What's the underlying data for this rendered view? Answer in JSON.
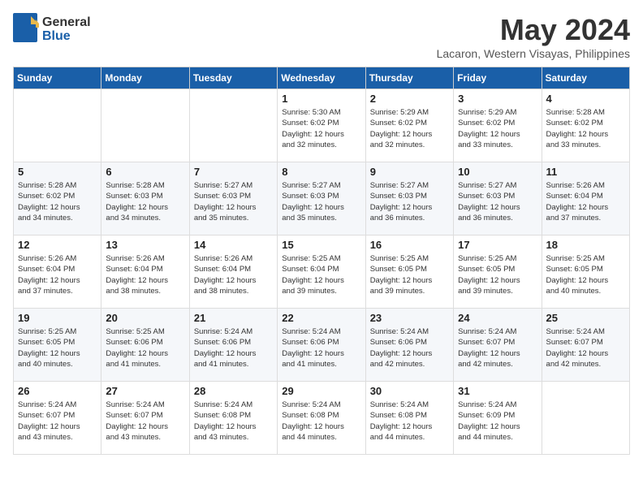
{
  "logo": {
    "general": "General",
    "blue": "Blue"
  },
  "title": "May 2024",
  "location": "Lacaron, Western Visayas, Philippines",
  "days_header": [
    "Sunday",
    "Monday",
    "Tuesday",
    "Wednesday",
    "Thursday",
    "Friday",
    "Saturday"
  ],
  "weeks": [
    [
      {
        "day": "",
        "info": ""
      },
      {
        "day": "",
        "info": ""
      },
      {
        "day": "",
        "info": ""
      },
      {
        "day": "1",
        "info": "Sunrise: 5:30 AM\nSunset: 6:02 PM\nDaylight: 12 hours\nand 32 minutes."
      },
      {
        "day": "2",
        "info": "Sunrise: 5:29 AM\nSunset: 6:02 PM\nDaylight: 12 hours\nand 32 minutes."
      },
      {
        "day": "3",
        "info": "Sunrise: 5:29 AM\nSunset: 6:02 PM\nDaylight: 12 hours\nand 33 minutes."
      },
      {
        "day": "4",
        "info": "Sunrise: 5:28 AM\nSunset: 6:02 PM\nDaylight: 12 hours\nand 33 minutes."
      }
    ],
    [
      {
        "day": "5",
        "info": "Sunrise: 5:28 AM\nSunset: 6:02 PM\nDaylight: 12 hours\nand 34 minutes."
      },
      {
        "day": "6",
        "info": "Sunrise: 5:28 AM\nSunset: 6:03 PM\nDaylight: 12 hours\nand 34 minutes."
      },
      {
        "day": "7",
        "info": "Sunrise: 5:27 AM\nSunset: 6:03 PM\nDaylight: 12 hours\nand 35 minutes."
      },
      {
        "day": "8",
        "info": "Sunrise: 5:27 AM\nSunset: 6:03 PM\nDaylight: 12 hours\nand 35 minutes."
      },
      {
        "day": "9",
        "info": "Sunrise: 5:27 AM\nSunset: 6:03 PM\nDaylight: 12 hours\nand 36 minutes."
      },
      {
        "day": "10",
        "info": "Sunrise: 5:27 AM\nSunset: 6:03 PM\nDaylight: 12 hours\nand 36 minutes."
      },
      {
        "day": "11",
        "info": "Sunrise: 5:26 AM\nSunset: 6:04 PM\nDaylight: 12 hours\nand 37 minutes."
      }
    ],
    [
      {
        "day": "12",
        "info": "Sunrise: 5:26 AM\nSunset: 6:04 PM\nDaylight: 12 hours\nand 37 minutes."
      },
      {
        "day": "13",
        "info": "Sunrise: 5:26 AM\nSunset: 6:04 PM\nDaylight: 12 hours\nand 38 minutes."
      },
      {
        "day": "14",
        "info": "Sunrise: 5:26 AM\nSunset: 6:04 PM\nDaylight: 12 hours\nand 38 minutes."
      },
      {
        "day": "15",
        "info": "Sunrise: 5:25 AM\nSunset: 6:04 PM\nDaylight: 12 hours\nand 39 minutes."
      },
      {
        "day": "16",
        "info": "Sunrise: 5:25 AM\nSunset: 6:05 PM\nDaylight: 12 hours\nand 39 minutes."
      },
      {
        "day": "17",
        "info": "Sunrise: 5:25 AM\nSunset: 6:05 PM\nDaylight: 12 hours\nand 39 minutes."
      },
      {
        "day": "18",
        "info": "Sunrise: 5:25 AM\nSunset: 6:05 PM\nDaylight: 12 hours\nand 40 minutes."
      }
    ],
    [
      {
        "day": "19",
        "info": "Sunrise: 5:25 AM\nSunset: 6:05 PM\nDaylight: 12 hours\nand 40 minutes."
      },
      {
        "day": "20",
        "info": "Sunrise: 5:25 AM\nSunset: 6:06 PM\nDaylight: 12 hours\nand 41 minutes."
      },
      {
        "day": "21",
        "info": "Sunrise: 5:24 AM\nSunset: 6:06 PM\nDaylight: 12 hours\nand 41 minutes."
      },
      {
        "day": "22",
        "info": "Sunrise: 5:24 AM\nSunset: 6:06 PM\nDaylight: 12 hours\nand 41 minutes."
      },
      {
        "day": "23",
        "info": "Sunrise: 5:24 AM\nSunset: 6:06 PM\nDaylight: 12 hours\nand 42 minutes."
      },
      {
        "day": "24",
        "info": "Sunrise: 5:24 AM\nSunset: 6:07 PM\nDaylight: 12 hours\nand 42 minutes."
      },
      {
        "day": "25",
        "info": "Sunrise: 5:24 AM\nSunset: 6:07 PM\nDaylight: 12 hours\nand 42 minutes."
      }
    ],
    [
      {
        "day": "26",
        "info": "Sunrise: 5:24 AM\nSunset: 6:07 PM\nDaylight: 12 hours\nand 43 minutes."
      },
      {
        "day": "27",
        "info": "Sunrise: 5:24 AM\nSunset: 6:07 PM\nDaylight: 12 hours\nand 43 minutes."
      },
      {
        "day": "28",
        "info": "Sunrise: 5:24 AM\nSunset: 6:08 PM\nDaylight: 12 hours\nand 43 minutes."
      },
      {
        "day": "29",
        "info": "Sunrise: 5:24 AM\nSunset: 6:08 PM\nDaylight: 12 hours\nand 44 minutes."
      },
      {
        "day": "30",
        "info": "Sunrise: 5:24 AM\nSunset: 6:08 PM\nDaylight: 12 hours\nand 44 minutes."
      },
      {
        "day": "31",
        "info": "Sunrise: 5:24 AM\nSunset: 6:09 PM\nDaylight: 12 hours\nand 44 minutes."
      },
      {
        "day": "",
        "info": ""
      }
    ]
  ]
}
